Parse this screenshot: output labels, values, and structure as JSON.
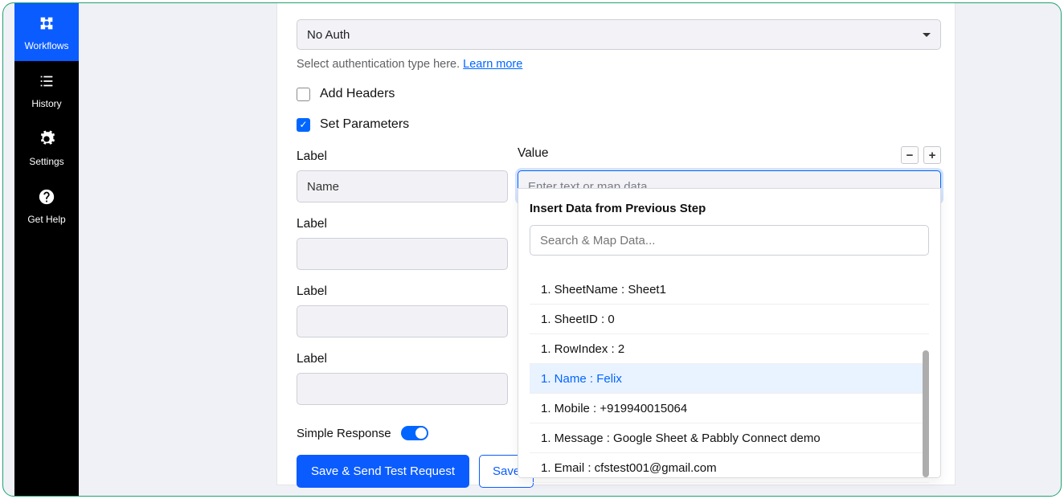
{
  "sidebar": {
    "items": [
      {
        "id": "workflows",
        "label": "Workflows",
        "icon": "workflow"
      },
      {
        "id": "history",
        "label": "History",
        "icon": "list"
      },
      {
        "id": "settings",
        "label": "Settings",
        "icon": "gear"
      },
      {
        "id": "gethelp",
        "label": "Get Help",
        "icon": "help"
      }
    ]
  },
  "auth": {
    "selected": "No Auth",
    "helper_prefix": "Select authentication type here. ",
    "learn_more": "Learn more"
  },
  "checkboxes": {
    "add_headers": "Add Headers",
    "set_parameters": "Set Parameters"
  },
  "params": {
    "label_header": "Label",
    "value_header": "Value",
    "value_placeholder": "Enter text or map data.",
    "rows": [
      {
        "label": "Name",
        "value": ""
      },
      {
        "label": "",
        "value": ""
      },
      {
        "label": "",
        "value": ""
      },
      {
        "label": "",
        "value": ""
      }
    ]
  },
  "simple_response_label": "Simple Response",
  "buttons": {
    "save_send": "Save & Send Test Request",
    "save": "Save"
  },
  "dropdown": {
    "title": "Insert Data from Previous Step",
    "search_placeholder": "Search & Map Data...",
    "items": [
      {
        "text": "1. SheetName : Sheet1",
        "hl": false
      },
      {
        "text": "1. SheetID : 0",
        "hl": false
      },
      {
        "text": "1. RowIndex : 2",
        "hl": false
      },
      {
        "text": "1. Name : Felix",
        "hl": true
      },
      {
        "text": "1. Mobile : +919940015064",
        "hl": false
      },
      {
        "text": "1. Message : Google Sheet & Pabbly Connect demo",
        "hl": false
      },
      {
        "text": "1. Email : cfstest001@gmail.com",
        "hl": false
      }
    ]
  }
}
